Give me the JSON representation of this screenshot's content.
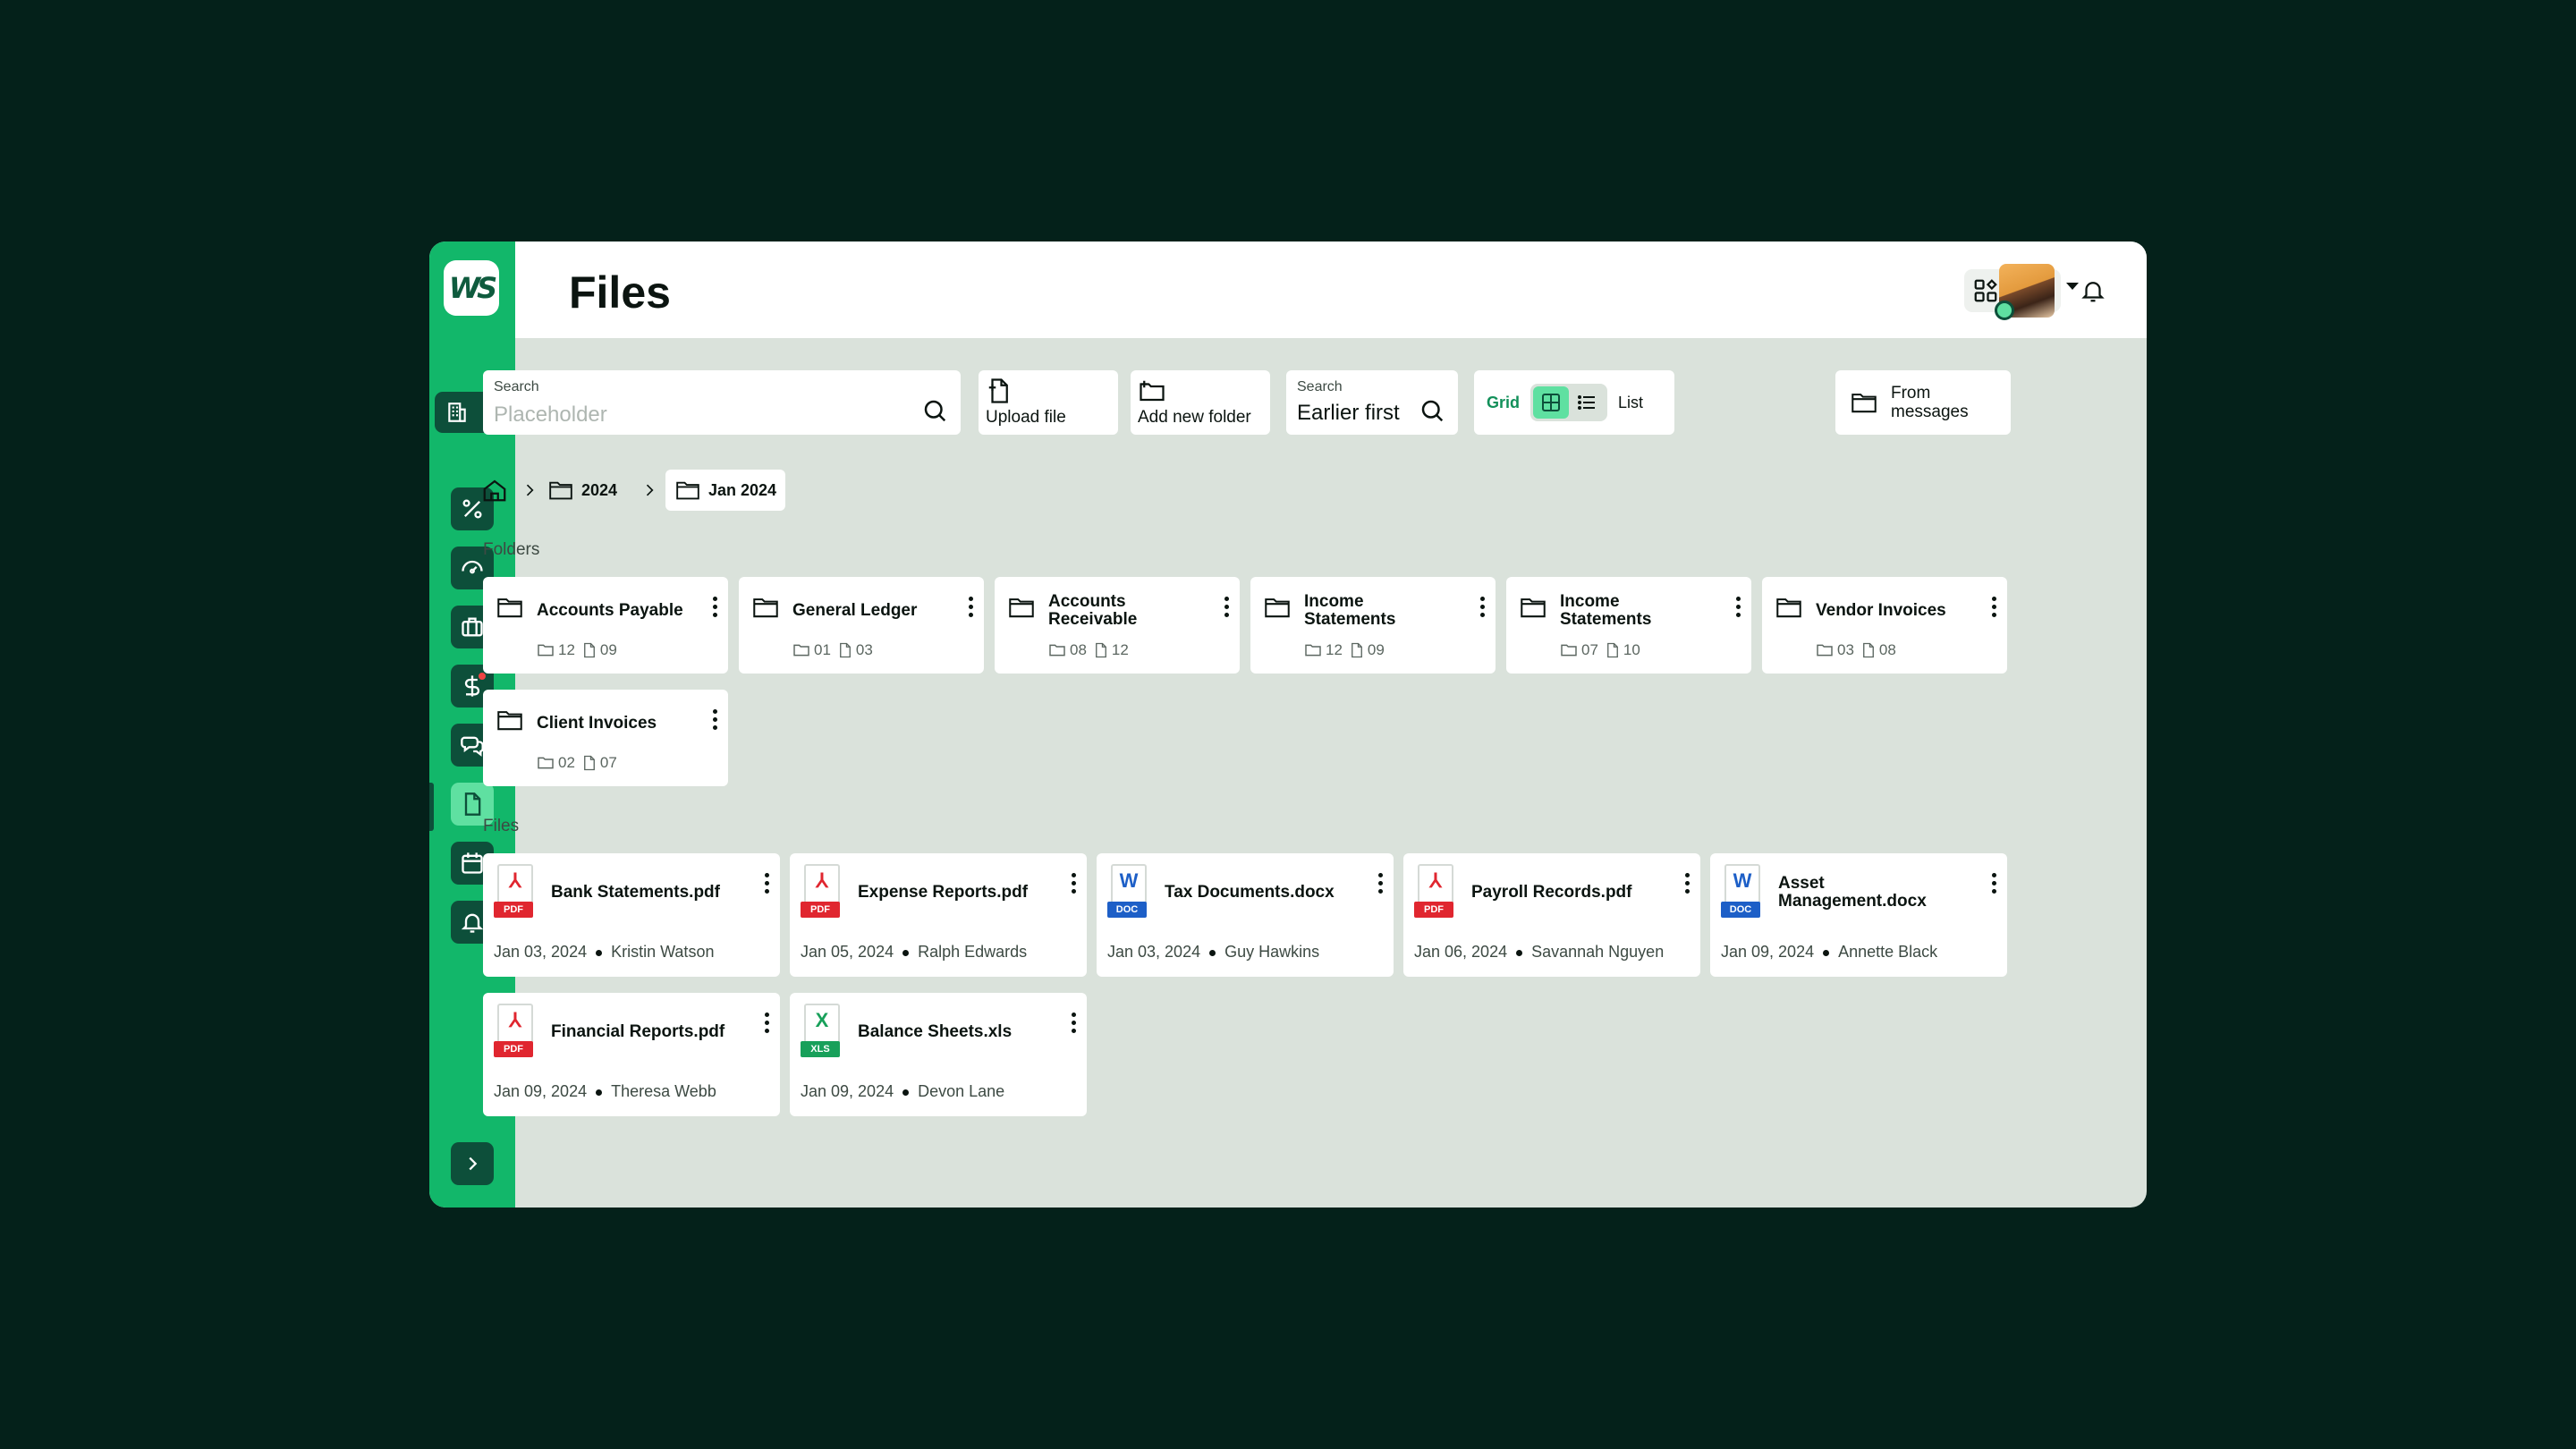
{
  "app": {
    "logo_text": "WS"
  },
  "header": {
    "title": "Files"
  },
  "toolbar": {
    "search_label": "Search",
    "search_placeholder": "Placeholder",
    "upload_label": "Upload file",
    "add_folder_label": "Add new folder",
    "sort_label": "Search",
    "sort_value": "Earlier first",
    "view_grid_label": "Grid",
    "view_list_label": "List",
    "from_messages_label": "From messages"
  },
  "breadcrumb": {
    "items": [
      "2024",
      "Jan 2024"
    ]
  },
  "sections": {
    "folders": "Folders",
    "files": "Files"
  },
  "folders": [
    {
      "name": "Accounts Payable",
      "folders": "12",
      "files": "09"
    },
    {
      "name": "General Ledger",
      "folders": "01",
      "files": "03"
    },
    {
      "name": "Accounts Receivable",
      "folders": "08",
      "files": "12"
    },
    {
      "name": "Income Statements",
      "folders": "12",
      "files": "09"
    },
    {
      "name": "Income Statements",
      "folders": "07",
      "files": "10"
    },
    {
      "name": "Vendor Invoices",
      "folders": "03",
      "files": "08"
    },
    {
      "name": "Client Invoices",
      "folders": "02",
      "files": "07"
    }
  ],
  "files": [
    {
      "name": "Bank Statements.pdf",
      "date": "Jan 03, 2024",
      "owner": "Kristin Watson",
      "type": "PDF",
      "glyph": "⅄"
    },
    {
      "name": "Expense Reports.pdf",
      "date": "Jan 05, 2024",
      "owner": "Ralph Edwards",
      "type": "PDF",
      "glyph": "⅄"
    },
    {
      "name": "Tax Documents.docx",
      "date": "Jan 03, 2024",
      "owner": "Guy Hawkins",
      "type": "DOC",
      "glyph": "W"
    },
    {
      "name": "Payroll Records.pdf",
      "date": "Jan 06, 2024",
      "owner": "Savannah Nguyen",
      "type": "PDF",
      "glyph": "⅄"
    },
    {
      "name": "Asset Management.docx",
      "date": "Jan 09, 2024",
      "owner": "Annette Black",
      "type": "DOC",
      "glyph": "W"
    },
    {
      "name": "Financial Reports.pdf",
      "date": "Jan 09, 2024",
      "owner": "Theresa Webb",
      "type": "PDF",
      "glyph": "⅄"
    },
    {
      "name": "Balance Sheets.xls",
      "date": "Jan 09, 2024",
      "owner": "Devon Lane",
      "type": "XLS",
      "glyph": "X"
    }
  ],
  "colors": {
    "background": "#04211a",
    "sidebar": "#12b76a",
    "sidebar_button": "#0d4f3a",
    "accent": "#5fe0a1",
    "pdf": "#e0262f",
    "doc": "#1d5fc7",
    "xls": "#18a05a",
    "notification_dot": "#ef4444"
  },
  "icons": {
    "sidebar": [
      "percent-icon",
      "gauge-icon",
      "briefcase-icon",
      "dollar-icon",
      "chat-icon",
      "file-icon",
      "calendar-icon",
      "bell-icon"
    ],
    "header": [
      "apps-icon",
      "users-icon",
      "bell-icon"
    ]
  }
}
